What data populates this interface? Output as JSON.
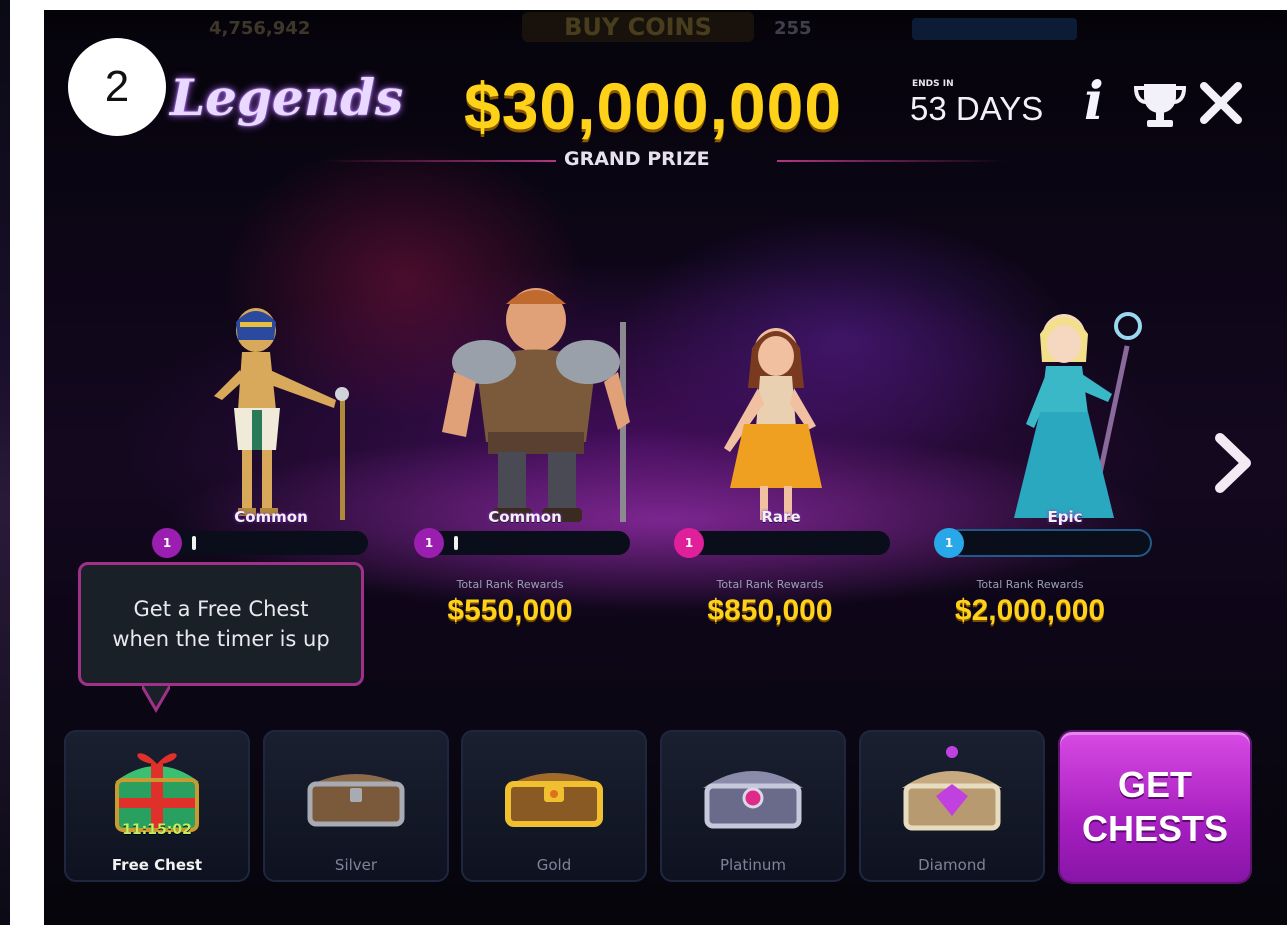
{
  "step_badge": "2",
  "top_bar": {
    "coins": "4,756,942",
    "buy_label": "BUY COINS",
    "stars": "255"
  },
  "header": {
    "title": "Legends",
    "grand_prize_amount": "$30,000,000",
    "grand_prize_label": "GRAND PRIZE",
    "ends_label": "ENDS IN",
    "ends_value": "53 DAYS",
    "info_icon": "i"
  },
  "heroes": [
    {
      "name": "pharaoh",
      "rarity": "Common",
      "rank": "1",
      "progress": 0.03,
      "rewards_label": "",
      "rewards_value": ""
    },
    {
      "name": "warrior",
      "rarity": "Common",
      "rank": "1",
      "progress": 0.03,
      "rewards_label": "Total Rank Rewards",
      "rewards_value": "$550,000"
    },
    {
      "name": "princess",
      "rarity": "Rare",
      "rank": "1",
      "progress": 0.0,
      "rewards_label": "Total Rank Rewards",
      "rewards_value": "$850,000"
    },
    {
      "name": "sorceress",
      "rarity": "Epic",
      "rank": "1",
      "progress": 0.0,
      "rewards_label": "Total Rank Rewards",
      "rewards_value": "$2,000,000"
    }
  ],
  "tooltip": {
    "line1": "Get a Free Chest",
    "line2": "when the timer is up"
  },
  "chests": [
    {
      "label": "Free Chest",
      "timer": "11:15:02"
    },
    {
      "label": "Silver"
    },
    {
      "label": "Gold"
    },
    {
      "label": "Platinum"
    },
    {
      "label": "Diamond"
    }
  ],
  "get_chests": {
    "line1": "GET",
    "line2": "CHESTS"
  },
  "colors": {
    "gold": "#ffd21a",
    "common_badge": "#9a1fb0",
    "rare_badge": "#e0209a",
    "epic_badge": "#28a8e8",
    "tooltip_border": "#a13088",
    "get_chests_bg": "#c030d6"
  },
  "icons": [
    "trophy-icon",
    "close-icon",
    "info-icon",
    "chevron-right-icon"
  ]
}
